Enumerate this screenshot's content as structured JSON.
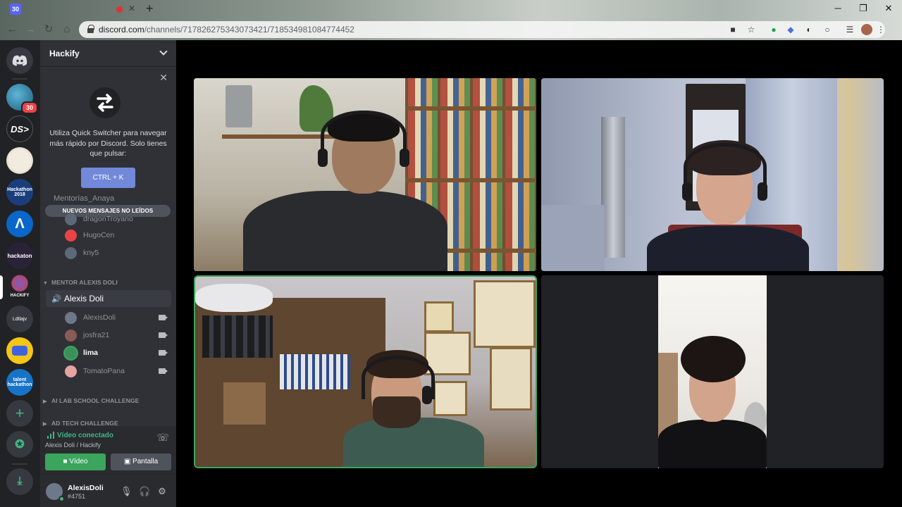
{
  "browser": {
    "tab_favicon_text": "30",
    "url_host": "discord.com",
    "url_path": "/channels/717826275343073421/718534981084774452",
    "icons": [
      "back-icon",
      "forward-icon",
      "reload-icon",
      "home-icon",
      "camera-icon",
      "star-icon",
      "extension-icon",
      "translate-icon",
      "profile-icon",
      "menu-icon"
    ]
  },
  "rail": {
    "servers": [
      {
        "label": "",
        "badge": "30"
      },
      {
        "label": "DS>"
      },
      {
        "label": ""
      },
      {
        "label": "Hackathon 2018"
      },
      {
        "label": "Λ"
      },
      {
        "label": "hackaton"
      },
      {
        "label": "HACKIFY"
      },
      {
        "label": "Ldtlajv"
      },
      {
        "label": ""
      },
      {
        "label": "talent hackathon"
      }
    ]
  },
  "guild": {
    "name": "Hackify"
  },
  "quick_switcher": {
    "text": "Utiliza Quick Switcher para navegar más rápido por Discord. Solo tienes que pulsar:",
    "button": "CTRL + K"
  },
  "new_messages": "NUEVOS MENSAJES NO LEÍDOS",
  "ghost_channel": "Mentorías_Anaya",
  "members_top": [
    {
      "name": "dragonTroyano",
      "avatar_color": "#5d6878"
    },
    {
      "name": "HugoCen",
      "avatar_color": "#ed4245"
    },
    {
      "name": "kny5",
      "avatar_color": "#5d6878"
    }
  ],
  "category_mentor": "MENTOR ALEXIS DOLI",
  "voice_channel": "Alexis Doli",
  "voice_members": [
    {
      "name": "AlexisDoli",
      "avatar_color": "#6d7889",
      "bold": false
    },
    {
      "name": "josfra21",
      "avatar_color": "#8a5a54",
      "bold": false
    },
    {
      "name": "lima",
      "avatar_color": "#3c8f5a",
      "bold": true
    },
    {
      "name": "TomatoPana",
      "avatar_color": "#e6a3a0",
      "bold": false
    }
  ],
  "categories_bottom": [
    "AI LAB SCHOOL CHALLENGE",
    "AD TECH CHALLENGE"
  ],
  "voice_panel": {
    "status": "Vídeo conectado",
    "sub": "Alexis Doli / Hackify",
    "video_button": "Vídeo",
    "screen_button": "Pantalla"
  },
  "user": {
    "name": "AlexisDoli",
    "tag": "#4751"
  },
  "colors": {
    "blurple": "#7289da",
    "green": "#3ba55d",
    "rail": "#202225",
    "sidebar": "#2f3136"
  }
}
